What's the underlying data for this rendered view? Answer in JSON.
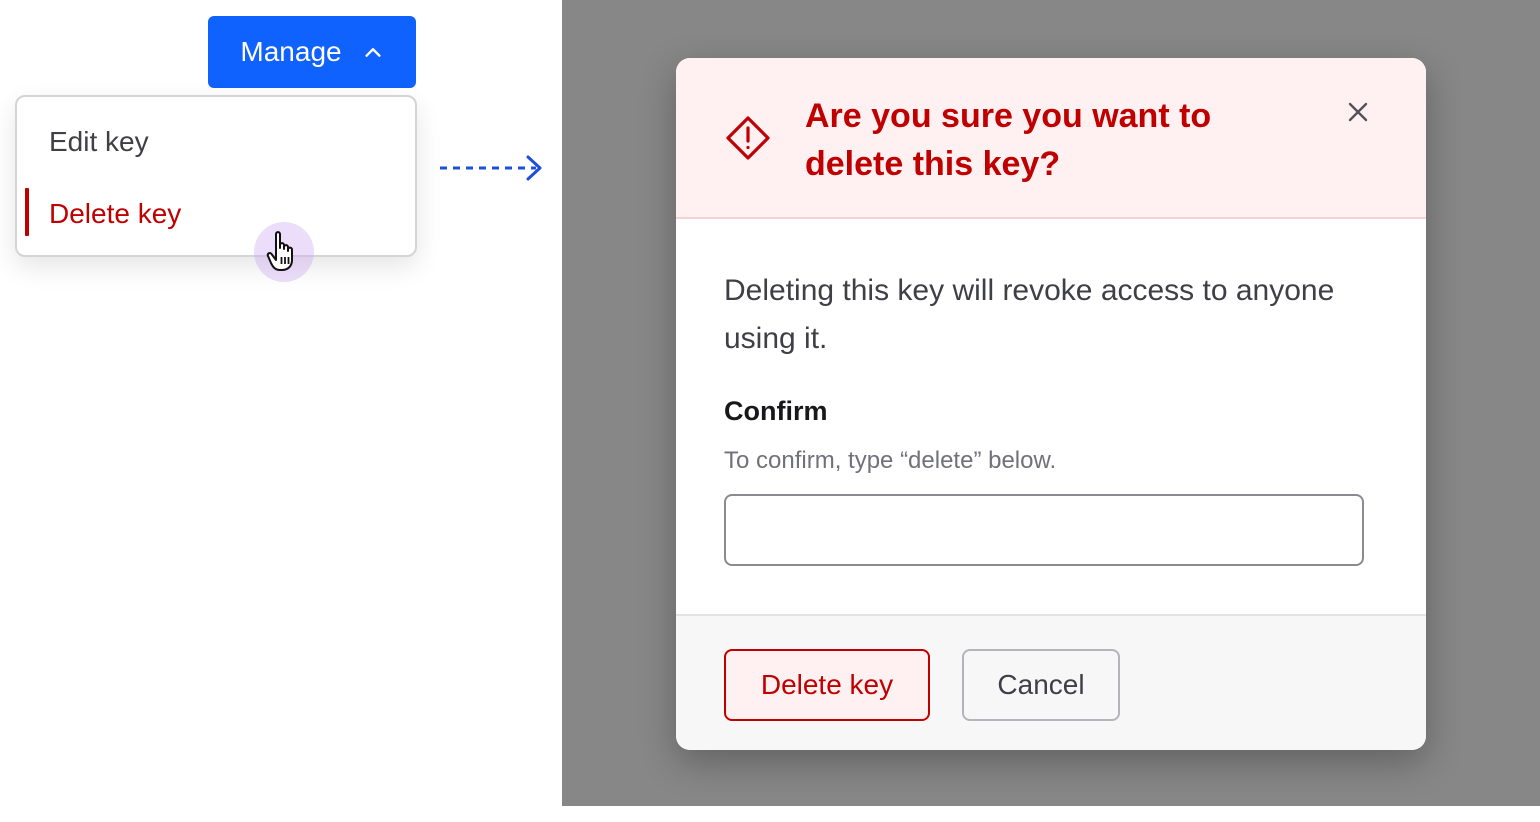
{
  "dropdown": {
    "manage_label": "Manage",
    "manage_icon": "chevron-up-icon",
    "accent_color": "#0f62fe",
    "items": [
      {
        "label": "Edit key",
        "state": "default"
      },
      {
        "label": "Delete key",
        "state": "active-danger"
      }
    ]
  },
  "modal": {
    "title": "Are you sure you want to delete this key?",
    "title_icon": "warning-diamond-icon",
    "close_icon": "close-icon",
    "danger_color": "#c00000",
    "body_text": "Deleting this key will revoke access to anyone using it.",
    "confirm_label": "Confirm",
    "confirm_help": "To confirm, type “delete” below.",
    "confirm_value": "",
    "delete_button": "Delete key",
    "cancel_button": "Cancel"
  }
}
